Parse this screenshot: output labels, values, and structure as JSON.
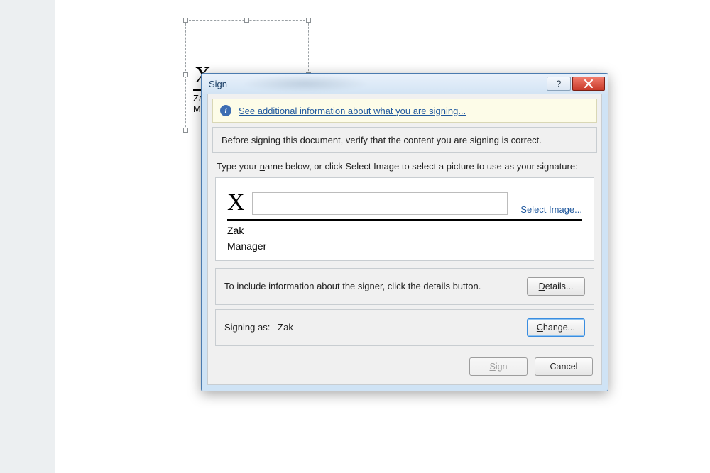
{
  "document": {
    "signature_object": {
      "x_mark": "X",
      "signer_name": "Zak",
      "signer_title": "Manager"
    }
  },
  "dialog": {
    "title": "Sign",
    "info_link": "See additional information about what you are signing...",
    "verify_text": "Before signing this document, verify that the content you are signing is correct.",
    "instruction_prefix": "Type your ",
    "instruction_name_u": "n",
    "instruction_name_rest": "ame below, or click Select Image to select a picture to use as your signature:",
    "preview": {
      "x_mark": "X",
      "name_value": "",
      "select_image_label": "Select Image...",
      "signer_name": "Zak",
      "signer_title": "Manager"
    },
    "details_section": {
      "text": "To include information about the signer, click the details button.",
      "button_u": "D",
      "button_rest": "etails..."
    },
    "signing_section": {
      "label": "Signing as:",
      "value": "Zak",
      "change_u": "C",
      "change_rest": "hange..."
    },
    "footer": {
      "sign_u": "S",
      "sign_rest": "ign",
      "cancel": "Cancel"
    },
    "titlebar": {
      "help_glyph": "?",
      "close_aria": "Close"
    }
  }
}
